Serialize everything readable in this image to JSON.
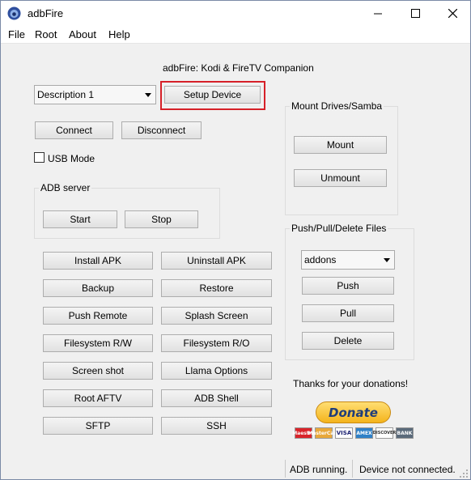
{
  "window": {
    "title": "adbFire"
  },
  "menu": [
    "File",
    "Root",
    "About",
    "Help"
  ],
  "heading": "adbFire:  Kodi & FireTV  Companion",
  "device_combo": {
    "selected": "Description 1"
  },
  "buttons": {
    "setup_device": "Setup Device",
    "connect": "Connect",
    "disconnect": "Disconnect",
    "start": "Start",
    "stop": "Stop",
    "install_apk": "Install APK",
    "uninstall_apk": "Uninstall APK",
    "backup": "Backup",
    "restore": "Restore",
    "push_remote": "Push Remote",
    "splash_screen": "Splash Screen",
    "filesystem_rw": "Filesystem R/W",
    "filesystem_ro": "Filesystem R/O",
    "screen_shot": "Screen shot",
    "llama_options": "Llama Options",
    "root_aftv": "Root AFTV",
    "adb_shell": "ADB Shell",
    "sftp": "SFTP",
    "ssh": "SSH",
    "mount": "Mount",
    "unmount": "Unmount",
    "push": "Push",
    "pull": "Pull",
    "delete": "Delete",
    "donate": "Donate"
  },
  "usb_mode": {
    "label": "USB Mode",
    "checked": false
  },
  "groups": {
    "adb_server": "ADB server",
    "mount_drives": "Mount Drives/Samba",
    "push_pull": "Push/Pull/Delete Files"
  },
  "files_combo": {
    "selected": "addons"
  },
  "thanks": "Thanks for your donations!",
  "cards": [
    "Maestro",
    "MasterCard",
    "VISA",
    "AMEX",
    "DISCOVER",
    "BANK"
  ],
  "status": {
    "adb": "ADB running.",
    "device": "Device not connected."
  },
  "colors": {
    "highlight": "#d62028",
    "donate": "#f4b41c"
  }
}
